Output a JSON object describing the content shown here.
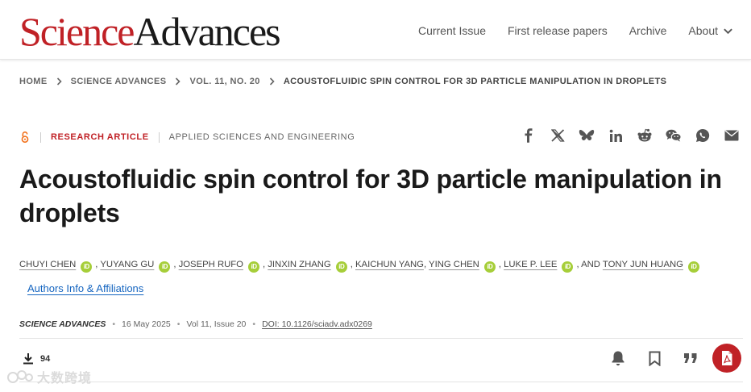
{
  "header": {
    "logo_science": "Science",
    "logo_advances": "Advances",
    "nav": [
      "Current Issue",
      "First release papers",
      "Archive",
      "About"
    ]
  },
  "breadcrumb": [
    "HOME",
    "SCIENCE ADVANCES",
    "VOL. 11, NO. 20",
    "ACOUSTOFLUIDIC SPIN CONTROL FOR 3D PARTICLE MANIPULATION IN DROPLETS"
  ],
  "article": {
    "type": "RESEARCH ARTICLE",
    "section": "APPLIED SCIENCES AND ENGINEERING",
    "title": "Acoustofluidic spin control for 3D particle manipulation in droplets",
    "orcid_glyph": "iD",
    "authors": [
      {
        "name": "CHUYI CHEN",
        "after": ","
      },
      {
        "name": "YUYANG GU",
        "after": ","
      },
      {
        "name": "JOSEPH RUFO",
        "after": ","
      },
      {
        "name": "JINXIN ZHANG",
        "after": ","
      },
      {
        "name": "KAICHUN YANG",
        "after": ","
      },
      {
        "name": "YING CHEN",
        "after": ","
      },
      {
        "name": "LUKE P. LEE",
        "after": ", AND"
      },
      {
        "name": "TONY JUN HUANG",
        "after": ""
      }
    ],
    "authors_info_link": "Authors Info & Affiliations",
    "journal": "SCIENCE ADVANCES",
    "date": "16 May 2025",
    "issue": "Vol 11, Issue 20",
    "doi": "DOI: 10.1126/sciadv.adx0269",
    "downloads": "94"
  },
  "share_icons": [
    "facebook-icon",
    "x-twitter-icon",
    "bluesky-icon",
    "linkedin-icon",
    "reddit-icon",
    "wechat-icon",
    "whatsapp-icon",
    "email-icon"
  ],
  "tool_icons": [
    "bell-icon",
    "bookmark-icon",
    "quote-icon",
    "pdf-icon"
  ],
  "watermark": "大数跨境",
  "colors": {
    "brand_red": "#c02126",
    "orcid_green": "#a6ce39",
    "link_blue": "#1565c0"
  }
}
